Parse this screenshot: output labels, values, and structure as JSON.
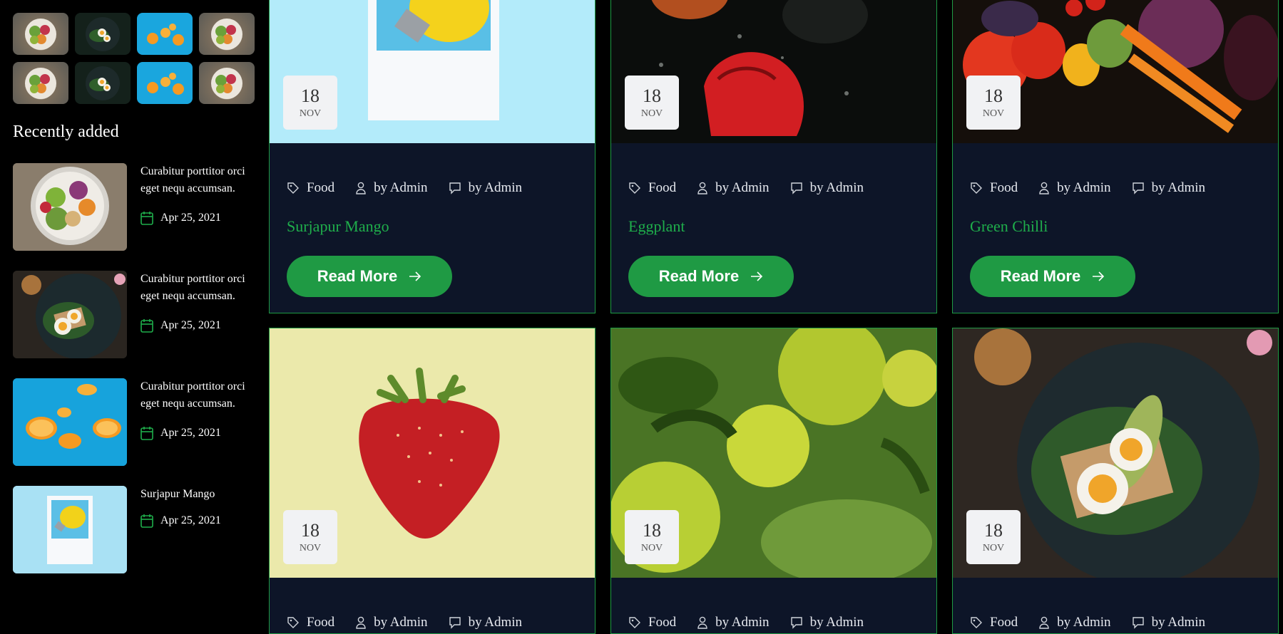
{
  "sidebar": {
    "thumb_icons": [
      "food-bowl-thumb",
      "egg-toast-thumb",
      "orange-slices-thumb",
      "food-bowl-thumb",
      "food-bowl-thumb",
      "egg-toast-thumb",
      "orange-slices-thumb",
      "food-bowl-thumb"
    ],
    "recent_title": "Recently added",
    "recent_items": [
      {
        "text": "Curabitur porttitor orci eget nequ accumsan.",
        "date": "Apr 25, 2021",
        "image": "salad-bowl"
      },
      {
        "text": "Curabitur porttitor orci eget nequ accumsan.",
        "date": "Apr 25, 2021",
        "image": "egg-toast"
      },
      {
        "text": "Curabitur porttitor orci eget nequ accumsan.",
        "date": "Apr 25, 2021",
        "image": "orange-slices"
      },
      {
        "text": "Surjapur Mango",
        "date": "Apr 25, 2021",
        "image": "lemon-bulb"
      }
    ]
  },
  "cards": [
    {
      "day": "18",
      "month": "NOV",
      "category": "Food",
      "author": "by Admin",
      "comments": "by Admin",
      "title": "Surjapur Mango",
      "button": "Read More",
      "image": "lemon-bulb"
    },
    {
      "day": "18",
      "month": "NOV",
      "category": "Food",
      "author": "by Admin",
      "comments": "by Admin",
      "title": "Eggplant",
      "button": "Read More",
      "image": "red-pepper"
    },
    {
      "day": "18",
      "month": "NOV",
      "category": "Food",
      "author": "by Admin",
      "comments": "by Admin",
      "title": "Green Chilli",
      "button": "Read More",
      "image": "vegetables"
    },
    {
      "day": "18",
      "month": "NOV",
      "category": "Food",
      "author": "by Admin",
      "comments": "by Admin",
      "title": "",
      "button": "",
      "image": "strawberry"
    },
    {
      "day": "18",
      "month": "NOV",
      "category": "Food",
      "author": "by Admin",
      "comments": "by Admin",
      "title": "",
      "button": "",
      "image": "green-fruits"
    },
    {
      "day": "18",
      "month": "NOV",
      "category": "Food",
      "author": "by Admin",
      "comments": "by Admin",
      "title": "",
      "button": "",
      "image": "egg-toast"
    }
  ],
  "colors": {
    "accent": "#1f9a44",
    "card_bg": "#0d1528",
    "title_green": "#1fae4b"
  }
}
